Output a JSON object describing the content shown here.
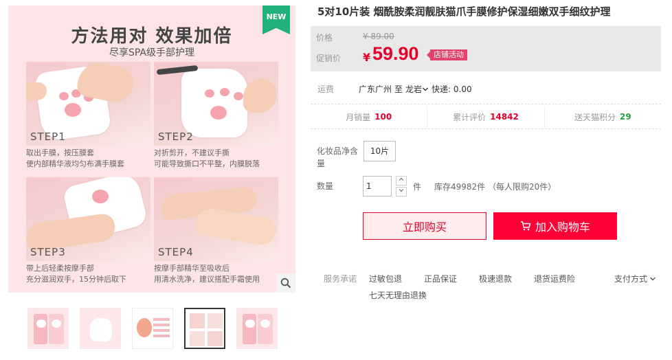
{
  "product": {
    "title": "5对10片装 烟酰胺柔润靓肤猫爪手膜修护保湿细嫩双手细纹护理"
  },
  "gallery": {
    "badge": "NEW",
    "banner_title": "方法用对  效果加倍",
    "banner_subtitle": "尽享SPA级手部护理",
    "steps": [
      {
        "label": "STEP1",
        "caption1": "取出手膜，按压膜套",
        "caption2": "使内部精华液均匀布满手膜套"
      },
      {
        "label": "STEP2",
        "caption1": "对折剪开，不建议手撕",
        "caption2": "可能导致撕口不平整，内膜脱落"
      },
      {
        "label": "STEP3",
        "caption1": "带上后轻柔按摩手部",
        "caption2": "充分滋润双手，15分钟后取下"
      },
      {
        "label": "STEP4",
        "caption1": "按摩手部精华至吸收后",
        "caption2": "用清水洗净，建议搭配手霜使用"
      }
    ],
    "zoom_icon": "search-icon",
    "thumbnails": [
      {
        "id": 1,
        "active": false
      },
      {
        "id": 2,
        "active": false
      },
      {
        "id": 3,
        "active": false
      },
      {
        "id": 4,
        "active": true
      },
      {
        "id": 5,
        "active": false
      }
    ]
  },
  "price": {
    "label": "价格",
    "original": "¥ 89.00",
    "promo_label": "促销价",
    "currency": "¥",
    "promo": "59.90",
    "promo_tag": "店铺活动",
    "accent_color": "#e4002b"
  },
  "shipping": {
    "label": "运费",
    "from": "广东广州",
    "to_word": "至",
    "to": "龙岩",
    "method": "快递: 0.00"
  },
  "stats": {
    "monthly_label": "月销量",
    "monthly_value": "100",
    "reviews_label": "累计评价",
    "reviews_value": "14842",
    "points_label": "送天猫积分",
    "points_value": "29"
  },
  "options": {
    "spec_label": "化妆品净含量",
    "spec_value": "10片",
    "qty_label": "数量",
    "qty_value": "1",
    "unit": "件",
    "stock": "库存49982件 （每人限购20件）"
  },
  "actions": {
    "buy_now": "立即购买",
    "add_cart": "加入购物车"
  },
  "services": {
    "label": "服务承诺",
    "items": [
      "过敏包退",
      "正品保证",
      "极速退款",
      "退货运费险",
      "七天无理由退换"
    ],
    "pay": "支付方式"
  }
}
